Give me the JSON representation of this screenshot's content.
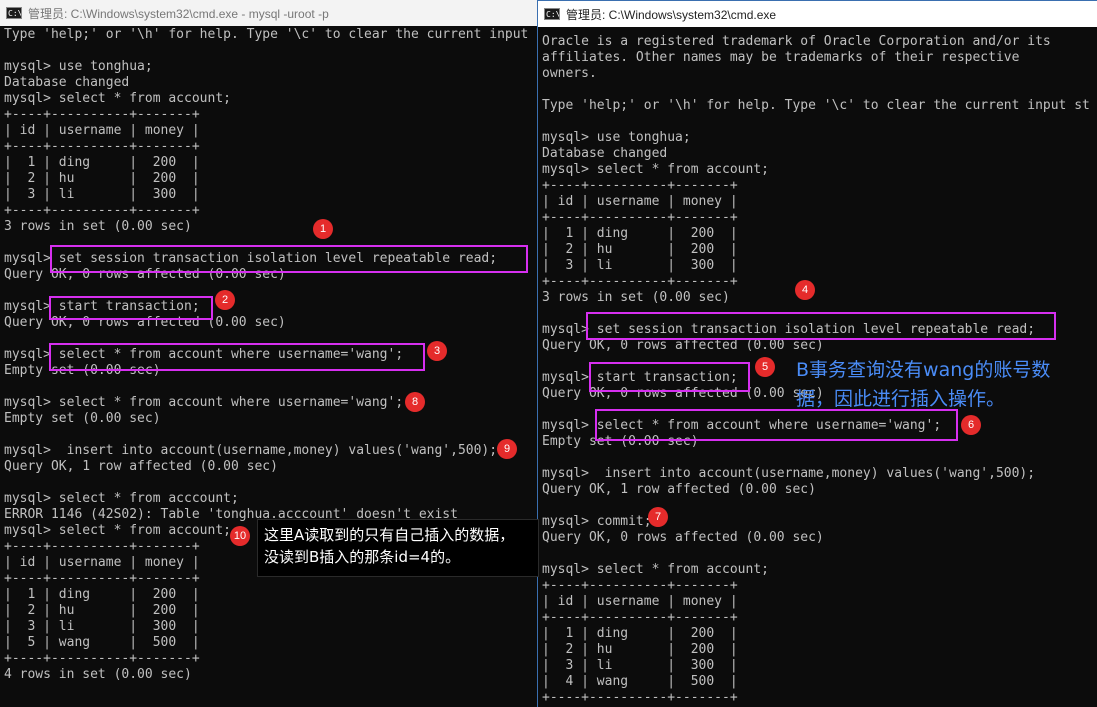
{
  "windowA": {
    "title": "管理员: C:\\Windows\\system32\\cmd.exe - mysql  -uroot -p",
    "lines": [
      "Type 'help;' or '\\h' for help. Type '\\c' to clear the current input",
      "",
      "mysql> use tonghua;",
      "Database changed",
      "mysql> select * from account;",
      "+----+----------+-------+",
      "| id | username | money |",
      "+----+----------+-------+",
      "|  1 | ding     |  200  |",
      "|  2 | hu       |  200  |",
      "|  3 | li       |  300  |",
      "+----+----------+-------+",
      "3 rows in set (0.00 sec)",
      "",
      "mysql> set session transaction isolation level repeatable read;",
      "Query OK, 0 rows affected (0.00 sec)",
      "",
      "mysql> start transaction;",
      "Query OK, 0 rows affected (0.00 sec)",
      "",
      "mysql> select * from account where username='wang';",
      "Empty set (0.00 sec)",
      "",
      "mysql> select * from account where username='wang';",
      "Empty set (0.00 sec)",
      "",
      "mysql>  insert into account(username,money) values('wang',500);",
      "Query OK, 1 row affected (0.00 sec)",
      "",
      "mysql> select * from acccount;",
      "ERROR 1146 (42S02): Table 'tonghua.acccount' doesn't exist",
      "mysql> select * from account;",
      "+----+----------+-------+",
      "| id | username | money |",
      "+----+----------+-------+",
      "|  1 | ding     |  200  |",
      "|  2 | hu       |  200  |",
      "|  3 | li       |  300  |",
      "|  5 | wang     |  500  |",
      "+----+----------+-------+",
      "4 rows in set (0.00 sec)"
    ]
  },
  "windowB": {
    "title": "管理员: C:\\Windows\\system32\\cmd.exe",
    "lines": [
      "Oracle is a registered trademark of Oracle Corporation and/or its",
      "affiliates. Other names may be trademarks of their respective",
      "owners.",
      "",
      "Type 'help;' or '\\h' for help. Type '\\c' to clear the current input st",
      "",
      "mysql> use tonghua;",
      "Database changed",
      "mysql> select * from account;",
      "+----+----------+-------+",
      "| id | username | money |",
      "+----+----------+-------+",
      "|  1 | ding     |  200  |",
      "|  2 | hu       |  200  |",
      "|  3 | li       |  300  |",
      "+----+----------+-------+",
      "3 rows in set (0.00 sec)",
      "",
      "mysql> set session transaction isolation level repeatable read;",
      "Query OK, 0 rows affected (0.00 sec)",
      "",
      "mysql> start transaction;",
      "Query OK, 0 rows affected (0.00 sec)",
      "",
      "mysql> select * from account where username='wang';",
      "Empty set (0.00 sec)",
      "",
      "mysql>  insert into account(username,money) values('wang',500);",
      "Query OK, 1 row affected (0.00 sec)",
      "",
      "mysql> commit;",
      "Query OK, 0 rows affected (0.00 sec)",
      "",
      "mysql> select * from account;",
      "+----+----------+-------+",
      "| id | username | money |",
      "+----+----------+-------+",
      "|  1 | ding     |  200  |",
      "|  2 | hu       |  200  |",
      "|  3 | li       |  300  |",
      "|  4 | wang     |  500  |",
      "+----+----------+-------+"
    ]
  },
  "annotations": {
    "badges": [
      "1",
      "2",
      "3",
      "8",
      "9",
      "10",
      "4",
      "5",
      "6",
      "7"
    ],
    "note_a": "这里A读取到的只有自己插入的数据，\n没读到B插入的那条id=4的。",
    "note_b": "B事务查询没有wang的账号数\n据，因此进行插入操作。"
  },
  "colors": {
    "terminal_bg": "#0c0c0c",
    "terminal_text": "#c0c0c0",
    "highlight_box": "#d62ff0",
    "badge": "#e52b2b",
    "note_b_text": "#4a8cf7"
  },
  "icons": {
    "window": "cmd-icon"
  }
}
